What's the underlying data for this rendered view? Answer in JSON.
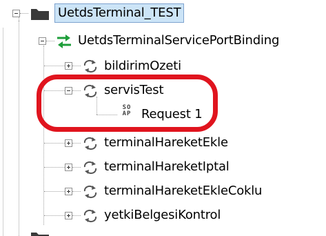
{
  "tree": {
    "project": {
      "label": "UetdsTerminal_TEST",
      "icon": "folder-icon",
      "expanded": true,
      "selected": true
    },
    "binding": {
      "label": "UetdsTerminalServicePortBinding",
      "icon": "binding-arrows-icon",
      "icon_color": "#1e9e3a",
      "expanded": true
    },
    "operations": [
      {
        "label": "bildirimOzeti",
        "icon": "operation-icon",
        "expanded": false
      },
      {
        "label": "servisTest",
        "icon": "operation-icon",
        "expanded": true
      },
      {
        "label": "terminalHareketEkle",
        "icon": "operation-icon",
        "expanded": false
      },
      {
        "label": "terminalHareketIptal",
        "icon": "operation-icon",
        "expanded": false
      },
      {
        "label": "terminalHareketEkleCoklu",
        "icon": "operation-icon",
        "expanded": false
      },
      {
        "label": "yetkiBelgesiKontrol",
        "icon": "operation-icon",
        "expanded": false
      }
    ],
    "request": {
      "label": "Request 1",
      "icon": "soap-request-icon",
      "icon_text_top": "SO",
      "icon_text_bottom": "AP"
    }
  },
  "annotation": {
    "shape": "rounded-rectangle",
    "color": "#e0141e"
  },
  "colors": {
    "selection_bg": "#cce4f7",
    "selection_border": "#7da2ce"
  }
}
